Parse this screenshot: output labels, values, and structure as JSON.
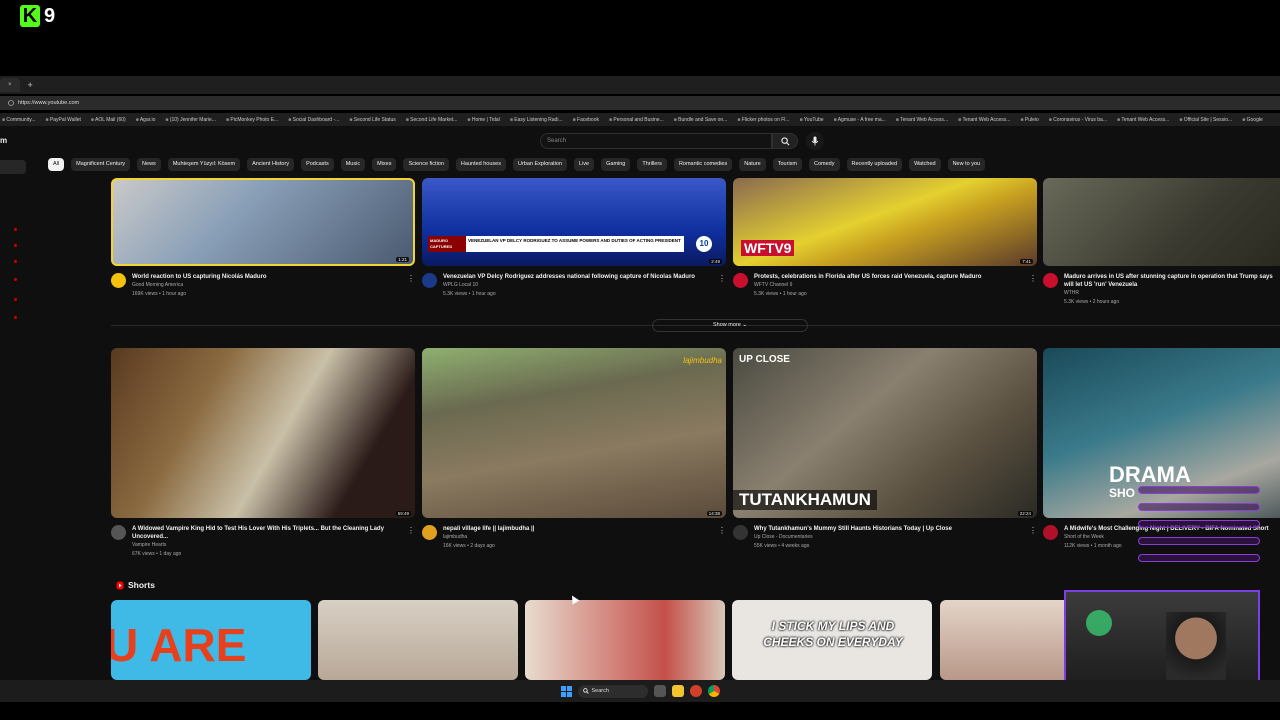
{
  "overlay": {
    "logo_letter": "K",
    "logo_number": "9"
  },
  "browser": {
    "tab_close": "×",
    "new_tab": "+",
    "url": "https://www.youtube.com",
    "bookmarks": [
      "Community...",
      "PayPal Wallet",
      "AOL Mail (60)",
      "Agar.io",
      "(10) Jennifer Marie...",
      "PicMonkey Photo E...",
      "Social Dashboard -...",
      "Second Life Status",
      "Second Life Market...",
      "Home | Tidal",
      "Easy Listening Radi...",
      "Facebook",
      "Personal and Busine...",
      "Bundle and Save on...",
      "Flicker photos on Fl...",
      "YouTube",
      "Agmuse - A free ma...",
      "Tenant Web Access...",
      "Tenant Web Access...",
      "Puleio",
      "Coronavirus - Virus ba...",
      "Tenant Web Access...",
      "Official Site | Sessio...",
      "Google"
    ]
  },
  "youtube": {
    "brand_partial": "m",
    "search_placeholder": "Search",
    "chips": [
      "All",
      "Magnificent Century",
      "News",
      "Muhteşem Yüzyıl: Kösem",
      "Ancient History",
      "Podcasts",
      "Music",
      "Mixes",
      "Science fiction",
      "Haunted houses",
      "Urban Exploration",
      "Live",
      "Gaming",
      "Thrillers",
      "Romantic comedies",
      "Nature",
      "Tourism",
      "Comedy",
      "Recently uploaded",
      "Watched",
      "New to you"
    ],
    "row1": [
      {
        "title": "World reaction to US capturing Nicolás Maduro",
        "channel": "Good Morning America",
        "stats": "169K views • 1 hour ago",
        "duration": "1:21",
        "avatar_color": "#f4c20d"
      },
      {
        "title": "Venezuelan VP Delcy Rodriguez addresses national following capture of Nicolas Maduro",
        "channel": "WPLG Local 10",
        "stats": "5.3K views • 1 hour ago",
        "duration": "2:49",
        "avatar_color": "#1b3a8a",
        "banner_tag": "MADURO CAPTURED",
        "banner_text": "VENEZUELAN VP DELCY RODRIGUEZ TO ASSUME POWERS AND DUTIES OF ACTING PRESIDENT",
        "badge": "10"
      },
      {
        "title": "Protests, celebrations in Florida after US forces raid Venezuela, capture Maduro",
        "channel": "WFTV Channel 9",
        "stats": "5.3K views • 1 hour ago",
        "duration": "7:41",
        "avatar_color": "#c8102e",
        "logo": "WFTV9"
      },
      {
        "title": "Maduro arrives in US after stunning capture in operation that Trump says will let US 'run' Venezuela",
        "channel": "WTHR",
        "stats": "5.3K views • 2 hours ago",
        "duration": "",
        "avatar_color": "#c8102e"
      }
    ],
    "show_more": "Show more",
    "row2": [
      {
        "title": "A Widowed Vampire King Hid to Test His Lover With His Triplets... But the Cleaning Lady Uncovered...",
        "channel": "Vampire Hearts",
        "stats": "67K views • 1 day ago",
        "duration": "59:49",
        "avatar_color": "#555"
      },
      {
        "title": "nepali village life || lajimbudha ||",
        "channel": "lajimbudha",
        "stats": "16K views • 2 days ago",
        "duration": "14:38",
        "avatar_color": "#e0a020",
        "watermark": "lajimbudha"
      },
      {
        "title": "Why Tutankhamun's Mummy Still Haunts Historians Today | Up Close",
        "channel": "Up Close - Documentaries",
        "stats": "55K views • 4 weeks ago",
        "duration": "22:24",
        "avatar_color": "#333",
        "tag": "UP CLOSE",
        "caption": "TUTANKHAMUN"
      },
      {
        "title": "A Midwife's Most Challenging Night | DELIVERY - BIFA Nominated Short",
        "channel": "Short of the Week",
        "stats": "112K views • 1 month ago",
        "duration": "",
        "avatar_color": "#b0102a",
        "caption": "DRAMA",
        "sub": "SHO"
      }
    ],
    "shorts_label": "Shorts",
    "shorts": [
      {
        "text": "U ARE",
        "bg": "#3fb9e6"
      },
      {
        "text": "",
        "bg": "#cfc7b8"
      },
      {
        "text": "",
        "bg": "#d8cfc2"
      },
      {
        "text": "I STICK MY LIPS AND CHEEKS ON EVERYDAY",
        "bg": "#e9e6e2"
      },
      {
        "text": "",
        "bg": "#d9c2b3"
      }
    ]
  },
  "taskbar": {
    "search_label": "Search"
  },
  "colors": {
    "accent": "#7b3fe4",
    "kick_green": "#53fc18",
    "yt_red": "#ff0000"
  }
}
